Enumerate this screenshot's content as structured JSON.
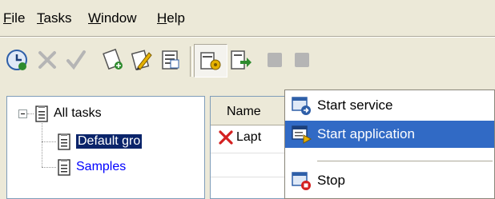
{
  "menubar": {
    "items": [
      {
        "label": "File",
        "mnemonic": "F",
        "rest": "ile"
      },
      {
        "label": "Tasks",
        "mnemonic": "T",
        "rest": "asks"
      },
      {
        "label": "Window",
        "mnemonic": "W",
        "rest": "indow"
      },
      {
        "label": "Help",
        "mnemonic": "H",
        "rest": "elp"
      }
    ]
  },
  "toolbar": {
    "buttons": [
      "schedule-icon",
      "delete-icon",
      "check-icon",
      "new-task-icon",
      "edit-task-icon",
      "properties-icon",
      "start-menu-icon",
      "export-icon",
      "stop-gray-icon",
      "pause-gray-icon"
    ]
  },
  "tree": {
    "root": "All tasks",
    "children": [
      "Default gro",
      "Samples"
    ]
  },
  "list": {
    "column_name": "Name",
    "rows": [
      {
        "name": "Lapt"
      }
    ]
  },
  "popup": {
    "items": [
      "Start service",
      "Start application",
      "Stop"
    ]
  },
  "colors": {
    "highlight": "#316ac5",
    "selection": "#0a246a",
    "link_blue": "#0000ff",
    "face": "#ece9d8"
  }
}
